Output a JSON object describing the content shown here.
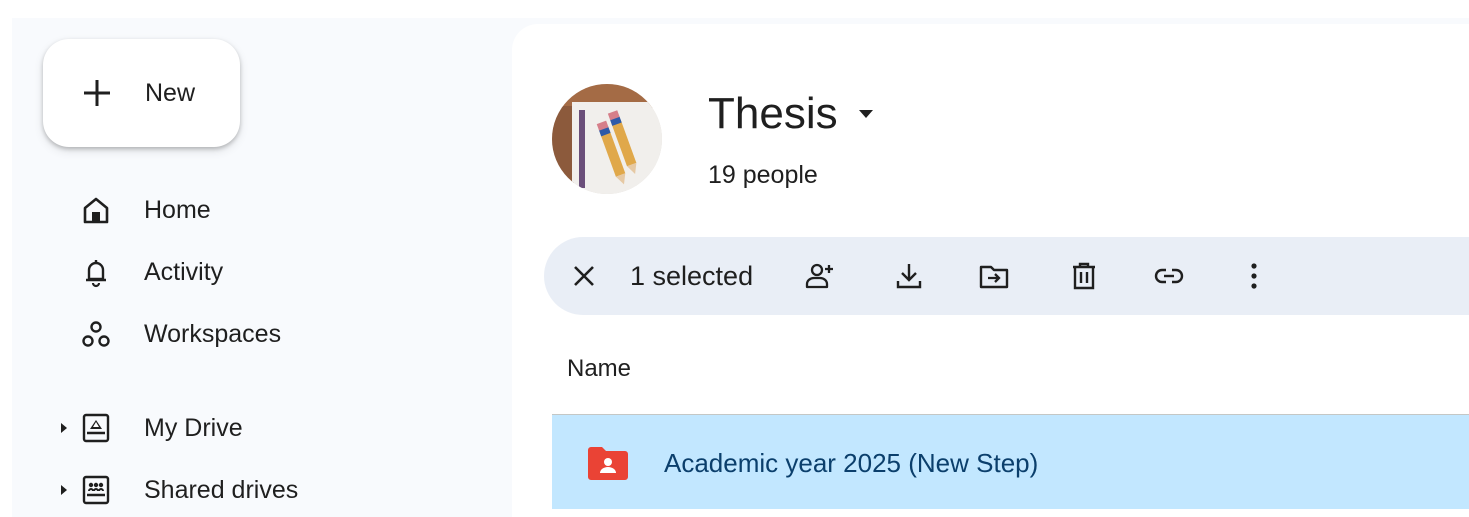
{
  "sidebar": {
    "new_label": "New",
    "items": [
      {
        "label": "Home",
        "icon": "home-icon"
      },
      {
        "label": "Activity",
        "icon": "bell-icon"
      },
      {
        "label": "Workspaces",
        "icon": "workspaces-icon"
      },
      {
        "label": "My Drive",
        "icon": "my-drive-icon",
        "expandable": true
      },
      {
        "label": "Shared drives",
        "icon": "shared-drives-icon",
        "expandable": true
      }
    ]
  },
  "header": {
    "title": "Thesis",
    "subtitle": "19 people"
  },
  "toolbar": {
    "selected_label": "1 selected",
    "actions": [
      "close-icon",
      "share-icon",
      "download-icon",
      "move-icon",
      "trash-icon",
      "link-icon",
      "more-vert-icon"
    ]
  },
  "table": {
    "column_name": "Name",
    "rows": [
      {
        "name": "Academic year 2025 (New Step)",
        "selected": true,
        "icon": "shared-folder-icon"
      }
    ]
  },
  "colors": {
    "sidebar_bg": "#f8fafd",
    "toolbar_bg": "#e9eef6",
    "selected_row": "#c2e7ff",
    "selected_text": "#0b3f6c",
    "folder_red": "#ea4335"
  }
}
